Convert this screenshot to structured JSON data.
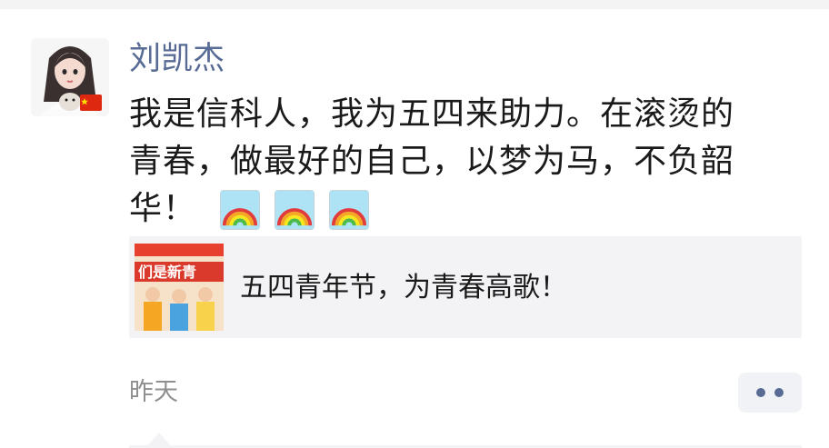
{
  "post": {
    "author": "刘凯杰",
    "content_lines": [
      "我是信科人，我为五四来助力。在滚烫的",
      "青春，做最好的自己，以梦为马，不负韶",
      "华！"
    ],
    "emojis": [
      "rainbow-icon",
      "rainbow-icon",
      "rainbow-icon"
    ],
    "link": {
      "title": "五四青年节，为青春高歌！",
      "thumb_banner": "们是新青"
    },
    "time": "昨天",
    "more_icon": "more-dots-icon"
  },
  "colors": {
    "name": "#576b95",
    "text": "#1a1a1a",
    "time": "#8f8f8f",
    "card_bg": "#f3f3f5"
  }
}
